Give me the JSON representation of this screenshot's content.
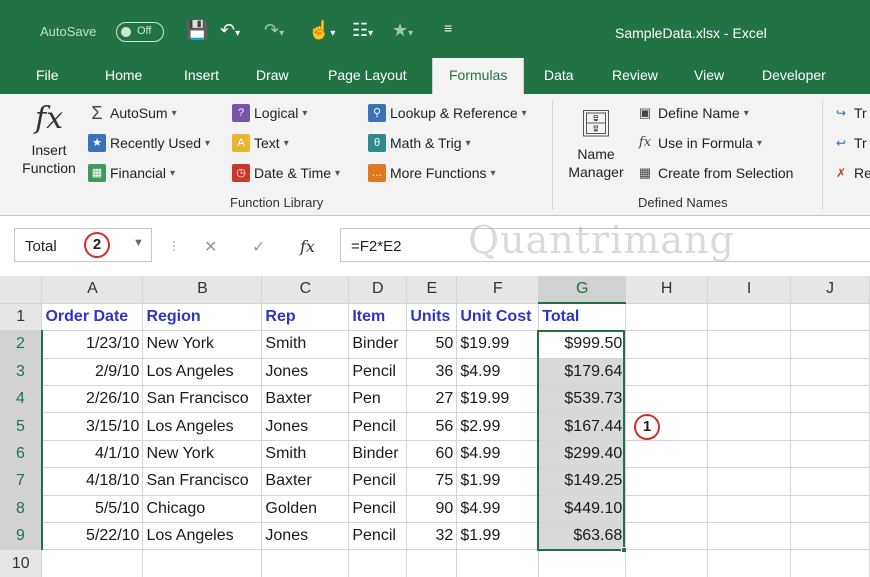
{
  "titlebar": {
    "autosave_label": "AutoSave",
    "autosave_state": "Off",
    "title": "SampleData.xlsx  -  Excel"
  },
  "tabs": [
    "File",
    "Home",
    "Insert",
    "Draw",
    "Page Layout",
    "Formulas",
    "Data",
    "Review",
    "View",
    "Developer"
  ],
  "active_tab": "Formulas",
  "ribbon": {
    "insert_function": [
      "Insert",
      "Function"
    ],
    "function_library": {
      "autosum": "AutoSum",
      "recently_used": "Recently Used",
      "financial": "Financial",
      "logical": "Logical",
      "text": "Text",
      "date_time": "Date & Time",
      "lookup": "Lookup & Reference",
      "math_trig": "Math & Trig",
      "more_functions": "More Functions",
      "group_label": "Function Library"
    },
    "defined_names": {
      "name_manager": [
        "Name",
        "Manager"
      ],
      "define_name": "Define Name",
      "use_in_formula": "Use in Formula",
      "create_from_selection": "Create from Selection",
      "group_label": "Defined Names"
    },
    "audit_partial": [
      "Tr",
      "Tr",
      "Re"
    ]
  },
  "formula_bar": {
    "name_box": "Total",
    "callout_2": "2",
    "fx": "fx",
    "formula": "=F2*E2",
    "watermark": "Quantrimang"
  },
  "grid": {
    "columns": [
      "A",
      "B",
      "C",
      "D",
      "E",
      "F",
      "G",
      "H",
      "I",
      "J"
    ],
    "selected_column": "G",
    "headers": [
      "Order Date",
      "Region",
      "Rep",
      "Item",
      "Units",
      "Unit Cost",
      "Total"
    ],
    "rows": [
      [
        "1/23/10",
        "New York",
        "Smith",
        "Binder",
        "50",
        "$19.99",
        "$999.50"
      ],
      [
        "2/9/10",
        "Los Angeles",
        "Jones",
        "Pencil",
        "36",
        "$4.99",
        "$179.64"
      ],
      [
        "2/26/10",
        "San Francisco",
        "Baxter",
        "Pen",
        "27",
        "$19.99",
        "$539.73"
      ],
      [
        "3/15/10",
        "Los Angeles",
        "Jones",
        "Pencil",
        "56",
        "$2.99",
        "$167.44"
      ],
      [
        "4/1/10",
        "New York",
        "Smith",
        "Binder",
        "60",
        "$4.99",
        "$299.40"
      ],
      [
        "4/18/10",
        "San Francisco",
        "Baxter",
        "Pencil",
        "75",
        "$1.99",
        "$149.25"
      ],
      [
        "5/5/10",
        "Chicago",
        "Golden",
        "Pencil",
        "90",
        "$4.99",
        "$449.10"
      ],
      [
        "5/22/10",
        "Los Angeles",
        "Jones",
        "Pencil",
        "32",
        "$1.99",
        "$63.68"
      ]
    ],
    "row_numbers": [
      "1",
      "2",
      "3",
      "4",
      "5",
      "6",
      "7",
      "8",
      "9",
      "10"
    ],
    "callout_1": "1"
  },
  "colors": {
    "excel_green": "#217346",
    "header_text": "#2e35c7",
    "callout_red": "#d0312d",
    "selection_fill": "#d9d9d9"
  }
}
